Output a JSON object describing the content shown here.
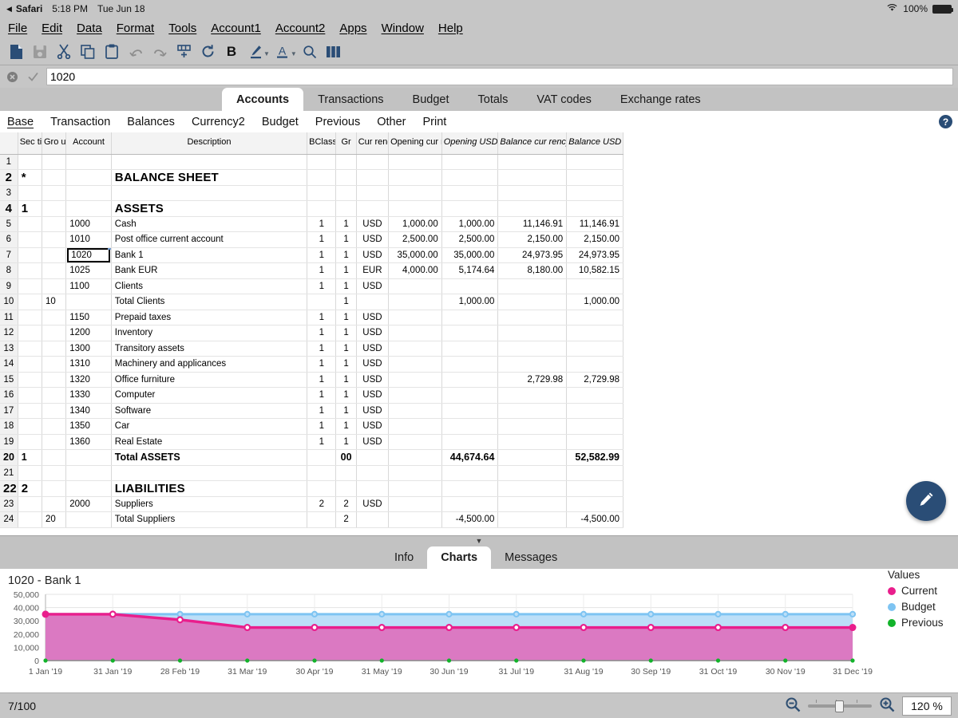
{
  "mac_bar": {
    "back_arrow": "◀",
    "app_name": "Safari",
    "time": "5:18 PM",
    "date": "Tue Jun 18",
    "battery_pct": "100%",
    "wifi_icon": "wifi-icon"
  },
  "menu_bar": {
    "items": [
      {
        "label": "File",
        "mnemonic": "F"
      },
      {
        "label": "Edit",
        "mnemonic": "E"
      },
      {
        "label": "Data",
        "mnemonic": "D"
      },
      {
        "label": "Format",
        "mnemonic": "o"
      },
      {
        "label": "Tools",
        "mnemonic": "T"
      },
      {
        "label": "Account1",
        "mnemonic": "1"
      },
      {
        "label": "Account2",
        "mnemonic": "2"
      },
      {
        "label": "Apps",
        "mnemonic": "A"
      },
      {
        "label": "Window",
        "mnemonic": "W"
      },
      {
        "label": "Help",
        "mnemonic": "H"
      }
    ]
  },
  "toolbar": {
    "icons": [
      "new-document-icon",
      "save-icon",
      "cut-icon",
      "copy-icon",
      "paste-icon",
      "undo-icon",
      "redo-icon",
      "add-row-icon",
      "refresh-icon",
      "bold-icon",
      "highlight-color-icon",
      "font-color-icon",
      "search-icon",
      "columns-icon"
    ],
    "bold_label": "B",
    "font_color_label": "A"
  },
  "formula_bar": {
    "cancel_icon": "cancel-icon",
    "accept_icon": "checkmark-icon",
    "value": "1020",
    "placeholder": ""
  },
  "main_tabs": {
    "active": "Accounts",
    "items": [
      "Accounts",
      "Transactions",
      "Budget",
      "Totals",
      "VAT codes",
      "Exchange rates"
    ]
  },
  "subnav": {
    "active": "Base",
    "items": [
      "Base",
      "Transaction",
      "Balances",
      "Currency2",
      "Budget",
      "Previous",
      "Other",
      "Print"
    ],
    "help_label": "?"
  },
  "sheet": {
    "headers": [
      {
        "label": "",
        "key": "rownum"
      },
      {
        "label": "Sec tion",
        "key": "section"
      },
      {
        "label": "Gro up",
        "key": "group"
      },
      {
        "label": "Account",
        "key": "account",
        "bold": true
      },
      {
        "label": "Description",
        "key": "description"
      },
      {
        "label": "BClass",
        "key": "bclass"
      },
      {
        "label": "Gr",
        "key": "gr"
      },
      {
        "label": "Cur rency",
        "key": "currency"
      },
      {
        "label": "Opening cur rency",
        "key": "opening_currency"
      },
      {
        "label": "Opening USD",
        "key": "opening_usd",
        "italic": true
      },
      {
        "label": "Balance cur rency",
        "key": "balance_currency",
        "italic": true
      },
      {
        "label": "Balance USD",
        "key": "balance_usd",
        "italic": true
      }
    ],
    "selected_cell": {
      "row": 7,
      "column": "Account",
      "value": "1020"
    },
    "rows": [
      {
        "rownum": "1",
        "section": "",
        "group": "",
        "account": "",
        "description": "",
        "bclass": "",
        "gr": "",
        "currency": "",
        "opening_currency": "",
        "opening_usd": "",
        "balance_currency": "",
        "balance_usd": ""
      },
      {
        "rownum": "2",
        "section": "*",
        "group": "",
        "account": "",
        "description": "BALANCE SHEET",
        "bclass": "",
        "gr": "",
        "currency": "",
        "opening_currency": "",
        "opening_usd": "",
        "balance_currency": "",
        "balance_usd": "",
        "style": "big"
      },
      {
        "rownum": "3",
        "section": "",
        "group": "",
        "account": "",
        "description": "",
        "bclass": "",
        "gr": "",
        "currency": "",
        "opening_currency": "",
        "opening_usd": "",
        "balance_currency": "",
        "balance_usd": ""
      },
      {
        "rownum": "4",
        "section": "1",
        "group": "",
        "account": "",
        "description": "ASSETS",
        "bclass": "",
        "gr": "",
        "currency": "",
        "opening_currency": "",
        "opening_usd": "",
        "balance_currency": "",
        "balance_usd": "",
        "style": "big"
      },
      {
        "rownum": "5",
        "section": "",
        "group": "",
        "account": "1000",
        "description": "Cash",
        "bclass": "1",
        "gr": "1",
        "currency": "USD",
        "opening_currency": "1,000.00",
        "opening_usd": "1,000.00",
        "balance_currency": "11,146.91",
        "balance_usd": "11,146.91"
      },
      {
        "rownum": "6",
        "section": "",
        "group": "",
        "account": "1010",
        "description": "Post office current account",
        "bclass": "1",
        "gr": "1",
        "currency": "USD",
        "opening_currency": "2,500.00",
        "opening_usd": "2,500.00",
        "balance_currency": "2,150.00",
        "balance_usd": "2,150.00"
      },
      {
        "rownum": "7",
        "section": "",
        "group": "",
        "account": "1020",
        "description": "Bank 1",
        "bclass": "1",
        "gr": "1",
        "currency": "USD",
        "opening_currency": "35,000.00",
        "opening_usd": "35,000.00",
        "balance_currency": "24,973.95",
        "balance_usd": "24,973.95",
        "selected": true
      },
      {
        "rownum": "8",
        "section": "",
        "group": "",
        "account": "1025",
        "description": "Bank EUR",
        "bclass": "1",
        "gr": "1",
        "currency": "EUR",
        "opening_currency": "4,000.00",
        "opening_usd": "5,174.64",
        "balance_currency": "8,180.00",
        "balance_usd": "10,582.15"
      },
      {
        "rownum": "9",
        "section": "",
        "group": "",
        "account": "1100",
        "description": "Clients",
        "bclass": "1",
        "gr": "1",
        "currency": "USD",
        "opening_currency": "",
        "opening_usd": "",
        "balance_currency": "",
        "balance_usd": ""
      },
      {
        "rownum": "10",
        "section": "",
        "group": "10",
        "account": "",
        "description": "Total Clients",
        "bclass": "",
        "gr": "1",
        "currency": "",
        "opening_currency": "",
        "opening_usd": "1,000.00",
        "balance_currency": "",
        "balance_usd": "1,000.00"
      },
      {
        "rownum": "11",
        "section": "",
        "group": "",
        "account": "1150",
        "description": "Prepaid taxes",
        "bclass": "1",
        "gr": "1",
        "currency": "USD",
        "opening_currency": "",
        "opening_usd": "",
        "balance_currency": "",
        "balance_usd": ""
      },
      {
        "rownum": "12",
        "section": "",
        "group": "",
        "account": "1200",
        "description": "Inventory",
        "bclass": "1",
        "gr": "1",
        "currency": "USD",
        "opening_currency": "",
        "opening_usd": "",
        "balance_currency": "",
        "balance_usd": ""
      },
      {
        "rownum": "13",
        "section": "",
        "group": "",
        "account": "1300",
        "description": "Transitory assets",
        "bclass": "1",
        "gr": "1",
        "currency": "USD",
        "opening_currency": "",
        "opening_usd": "",
        "balance_currency": "",
        "balance_usd": ""
      },
      {
        "rownum": "14",
        "section": "",
        "group": "",
        "account": "1310",
        "description": "Machinery and applicances",
        "bclass": "1",
        "gr": "1",
        "currency": "USD",
        "opening_currency": "",
        "opening_usd": "",
        "balance_currency": "",
        "balance_usd": ""
      },
      {
        "rownum": "15",
        "section": "",
        "group": "",
        "account": "1320",
        "description": "Office furniture",
        "bclass": "1",
        "gr": "1",
        "currency": "USD",
        "opening_currency": "",
        "opening_usd": "",
        "balance_currency": "2,729.98",
        "balance_usd": "2,729.98"
      },
      {
        "rownum": "16",
        "section": "",
        "group": "",
        "account": "1330",
        "description": "Computer",
        "bclass": "1",
        "gr": "1",
        "currency": "USD",
        "opening_currency": "",
        "opening_usd": "",
        "balance_currency": "",
        "balance_usd": ""
      },
      {
        "rownum": "17",
        "section": "",
        "group": "",
        "account": "1340",
        "description": "Software",
        "bclass": "1",
        "gr": "1",
        "currency": "USD",
        "opening_currency": "",
        "opening_usd": "",
        "balance_currency": "",
        "balance_usd": ""
      },
      {
        "rownum": "18",
        "section": "",
        "group": "",
        "account": "1350",
        "description": "Car",
        "bclass": "1",
        "gr": "1",
        "currency": "USD",
        "opening_currency": "",
        "opening_usd": "",
        "balance_currency": "",
        "balance_usd": ""
      },
      {
        "rownum": "19",
        "section": "",
        "group": "",
        "account": "1360",
        "description": "Real Estate",
        "bclass": "1",
        "gr": "1",
        "currency": "USD",
        "opening_currency": "",
        "opening_usd": "",
        "balance_currency": "",
        "balance_usd": ""
      },
      {
        "rownum": "20",
        "section": "1",
        "group": "",
        "account": "",
        "description": "Total ASSETS",
        "bclass": "",
        "gr": "00",
        "currency": "",
        "opening_currency": "",
        "opening_usd": "44,674.64",
        "balance_currency": "",
        "balance_usd": "52,582.99",
        "style": "tot"
      },
      {
        "rownum": "21",
        "section": "",
        "group": "",
        "account": "",
        "description": "",
        "bclass": "",
        "gr": "",
        "currency": "",
        "opening_currency": "",
        "opening_usd": "",
        "balance_currency": "",
        "balance_usd": ""
      },
      {
        "rownum": "22",
        "section": "2",
        "group": "",
        "account": "",
        "description": "LIABILITIES",
        "bclass": "",
        "gr": "",
        "currency": "",
        "opening_currency": "",
        "opening_usd": "",
        "balance_currency": "",
        "balance_usd": "",
        "style": "big"
      },
      {
        "rownum": "23",
        "section": "",
        "group": "",
        "account": "2000",
        "description": "Suppliers",
        "bclass": "2",
        "gr": "2",
        "currency": "USD",
        "opening_currency": "",
        "opening_usd": "",
        "balance_currency": "",
        "balance_usd": ""
      },
      {
        "rownum": "24",
        "section": "",
        "group": "20",
        "account": "",
        "description": "Total Suppliers",
        "bclass": "",
        "gr": "2",
        "currency": "",
        "opening_currency": "",
        "opening_usd": "-4,500.00",
        "balance_currency": "",
        "balance_usd": "-4,500.00",
        "neg": true
      }
    ]
  },
  "fab": {
    "icon": "pencil-icon",
    "color": "#2a4d76"
  },
  "bottom_tabs": {
    "active": "Charts",
    "items": [
      "Info",
      "Charts",
      "Messages"
    ]
  },
  "chart_data": {
    "type": "area",
    "title": "1020 - Bank 1",
    "xlabel": "",
    "ylabel": "",
    "ylim": [
      0,
      50000
    ],
    "yticks": [
      0,
      10000,
      20000,
      30000,
      40000,
      50000
    ],
    "ytick_labels": [
      "0",
      "10,000",
      "20,000",
      "30,000",
      "40,000",
      "50,000"
    ],
    "grid": true,
    "legend_title": "Values",
    "legend_position": "right",
    "categories": [
      "1 Jan '19",
      "31 Jan '19",
      "28 Feb '19",
      "31 Mar '19",
      "30 Apr '19",
      "31 May '19",
      "30 Jun '19",
      "31 Jul '19",
      "31 Aug '19",
      "30 Sep '19",
      "31 Oct '19",
      "30 Nov '19",
      "31 Dec '19"
    ],
    "series": [
      {
        "name": "Current",
        "color": "#e91e8c",
        "values": [
          35000,
          35000,
          30800,
          24974,
          24974,
          24974,
          24974,
          24974,
          24974,
          24974,
          24974,
          24974,
          24974
        ]
      },
      {
        "name": "Budget",
        "color": "#7ec4f2",
        "values": [
          35000,
          35000,
          35000,
          35000,
          35000,
          35000,
          35000,
          35000,
          35000,
          35000,
          35000,
          35000,
          35000
        ]
      },
      {
        "name": "Previous",
        "color": "#12b32a",
        "values": [
          0,
          0,
          0,
          0,
          0,
          0,
          0,
          0,
          0,
          0,
          0,
          0,
          0
        ]
      }
    ]
  },
  "status_bar": {
    "position": "7/100",
    "zoom_out_icon": "zoom-out-icon",
    "zoom_in_icon": "zoom-in-icon",
    "zoom_value": "120 %"
  }
}
